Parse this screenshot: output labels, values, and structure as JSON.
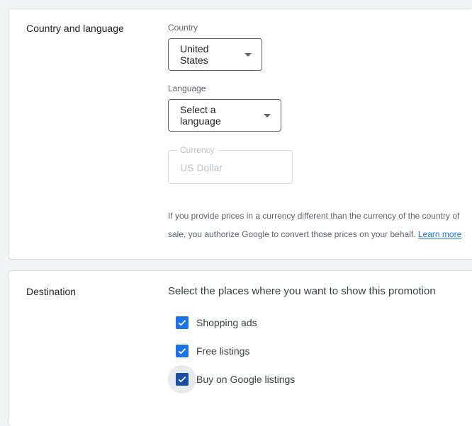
{
  "country_language": {
    "section_title": "Country and language",
    "country_label": "Country",
    "country_value": "United States",
    "language_label": "Language",
    "language_value": "Select a language",
    "currency_label": "Currency",
    "currency_value": "US Dollar",
    "helper_text": "If you provide prices in a currency different than the currency of the country of sale, you authorize Google to convert those prices on your behalf.",
    "learn_more": "Learn more"
  },
  "destination": {
    "section_title": "Destination",
    "heading": "Select the places where you want to show this promotion",
    "options": [
      {
        "label": "Shopping ads",
        "checked": true
      },
      {
        "label": "Free listings",
        "checked": true
      },
      {
        "label": "Buy on Google listings",
        "checked": true
      }
    ]
  },
  "colors": {
    "accent": "#1a73e8",
    "checkbox_focused": "#174ea6",
    "card_border": "#dadce0",
    "background": "#f1f3f4"
  }
}
